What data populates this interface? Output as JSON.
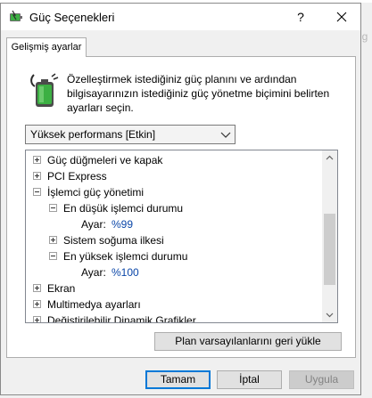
{
  "background": {
    "peek_text": "ig"
  },
  "window": {
    "title": "Güç Seçenekleri",
    "help_label": "?",
    "icons": {
      "app": "power-options-icon",
      "close": "close-icon"
    }
  },
  "tab": {
    "label": "Gelişmiş ayarlar"
  },
  "description": "Özelleştirmek istediğiniz güç planını ve ardından bilgisayarınızın istediğiniz güç yönetme biçimini belirten ayarları seçin.",
  "plan_select": {
    "value": "Yüksek performans [Etkin]"
  },
  "tree": {
    "items": [
      {
        "label": "Güç düğmeleri ve kapak",
        "expander": "plus",
        "level": 0
      },
      {
        "label": "PCI Express",
        "expander": "plus",
        "level": 0
      },
      {
        "label": "İşlemci güç yönetimi",
        "expander": "minus",
        "level": 0
      },
      {
        "label": "En düşük işlemci durumu",
        "expander": "minus",
        "level": 1
      },
      {
        "label": "Ayar:",
        "value": "%99",
        "level": 2
      },
      {
        "label": "Sistem soğuma ilkesi",
        "expander": "plus",
        "level": 1
      },
      {
        "label": "En yüksek işlemci durumu",
        "expander": "minus",
        "level": 1
      },
      {
        "label": "Ayar:",
        "value": "%100",
        "level": 2
      },
      {
        "label": "Ekran",
        "expander": "plus",
        "level": 0
      },
      {
        "label": "Multimedya ayarları",
        "expander": "plus",
        "level": 0
      },
      {
        "label": "Değiştirilebilir Dinamik Grafikler",
        "expander": "plus",
        "level": 0
      }
    ]
  },
  "buttons": {
    "restore": "Plan varsayılanlarını geri yükle",
    "ok": "Tamam",
    "cancel": "İptal",
    "apply": "Uygula"
  },
  "colors": {
    "setting_value": "#0a46a8",
    "default_button_border": "#0078d7",
    "battery_green": "#3cb043"
  }
}
